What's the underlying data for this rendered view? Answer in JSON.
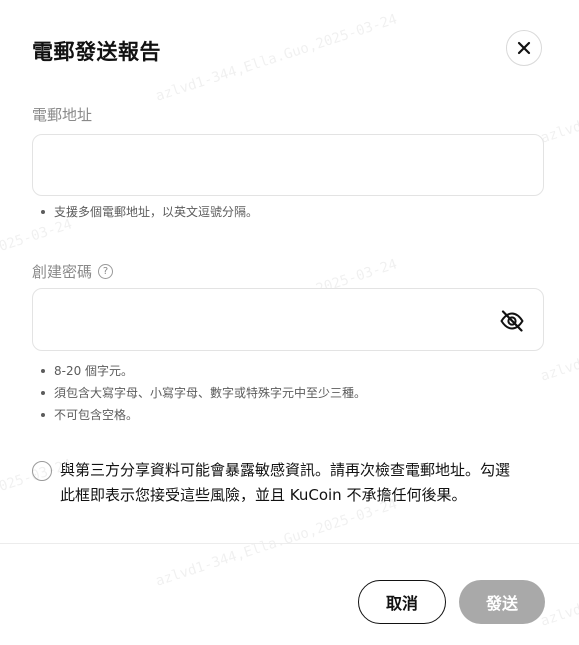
{
  "dialog": {
    "title": "電郵發送報告"
  },
  "email_field": {
    "label": "電郵地址",
    "value": "",
    "placeholder": "",
    "hints": [
      "支援多個電郵地址，以英文逗號分隔。"
    ]
  },
  "password_field": {
    "label": "創建密碼",
    "help_icon_glyph": "?",
    "value": "",
    "placeholder": "",
    "hints": [
      "8-20 個字元。",
      "須包含大寫字母、小寫字母、數字或特殊字元中至少三種。",
      "不可包含空格。"
    ]
  },
  "consent": {
    "line1": "與第三方分享資料可能會暴露敏感資訊。請再次檢查電郵地址。勾選",
    "line2": "此框即表示您接受這些風險，並且 KuCoin 不承擔任何後果。",
    "checked": false
  },
  "buttons": {
    "cancel_label": "取消",
    "send_label": "發送"
  },
  "watermark": {
    "text": "azlvd1-344,Ella.Guo,2025-03-24"
  },
  "colors": {
    "text_primary": "#121212",
    "text_muted": "#8a8a8a",
    "border": "#e3e3e3",
    "send_disabled": "#a9a9a9"
  }
}
